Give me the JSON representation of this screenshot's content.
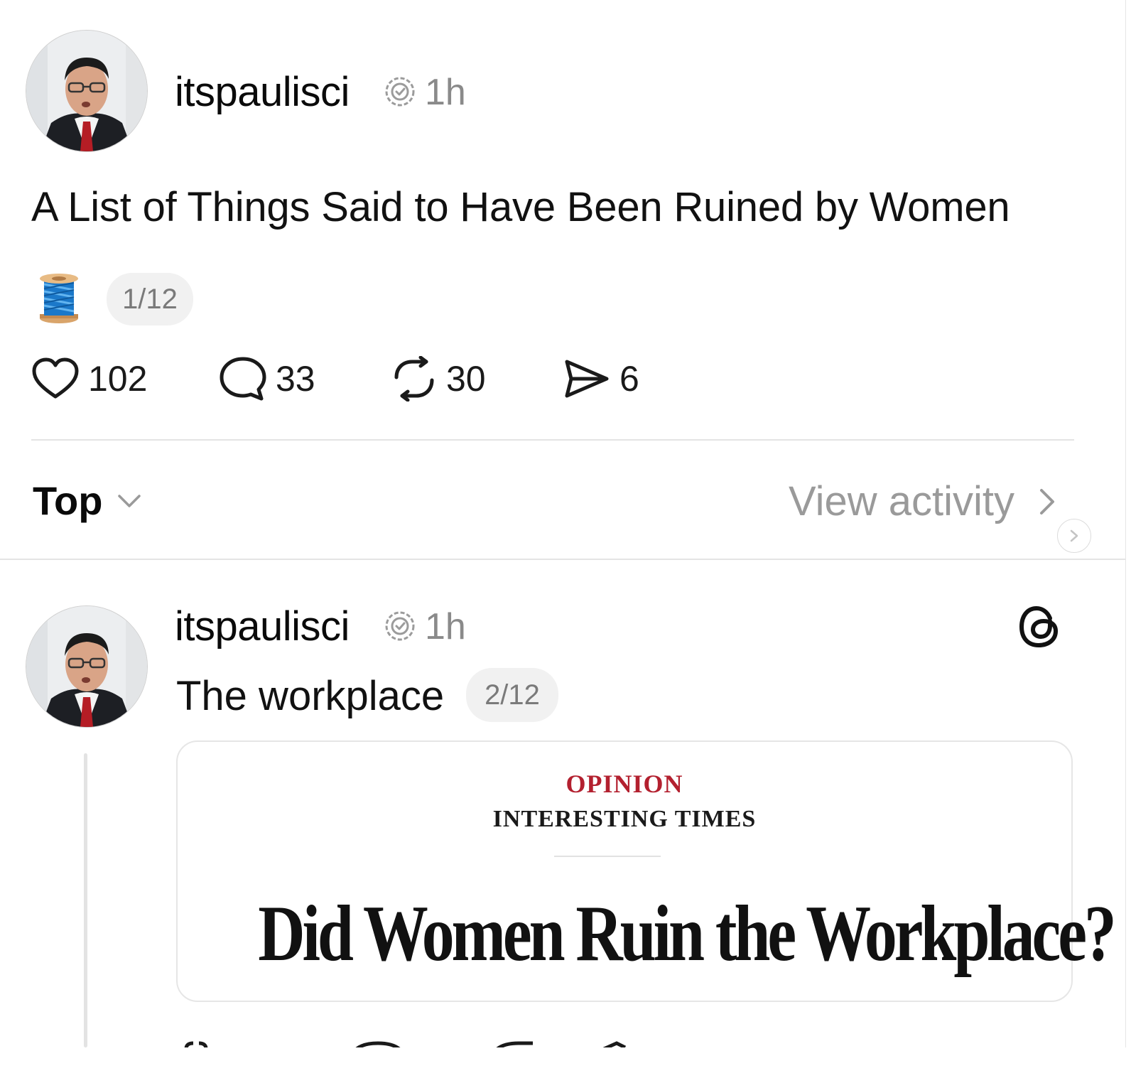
{
  "post": {
    "username": "itspaulisci",
    "time": "1h",
    "title": "A List of Things Said to Have Been Ruined by Women",
    "page_pill": "1/12",
    "actions": {
      "likes": "102",
      "comments": "33",
      "reposts": "30",
      "shares": "6"
    }
  },
  "sort": {
    "label": "Top",
    "view_activity": "View activity"
  },
  "reply": {
    "username": "itspaulisci",
    "time": "1h",
    "text": "The workplace",
    "page_pill": "2/12",
    "card": {
      "kicker": "OPINION",
      "section": "INTERESTING TIMES",
      "headline": "Did Women Ruin the Workplace?"
    }
  },
  "icons": {
    "verified": "verified-badge-icon",
    "like": "heart-icon",
    "comment": "comment-bubble-icon",
    "repost": "repost-icon",
    "share": "send-icon",
    "chevron_down": "chevron-down-icon",
    "chevron_right": "chevron-right-icon",
    "threads": "threads-logo-icon",
    "thread_emoji": "spool-of-thread-emoji"
  },
  "colors": {
    "accent_red": "#b3202f",
    "muted_text": "#8a8a8a",
    "pill_bg": "#f1f1f1"
  }
}
